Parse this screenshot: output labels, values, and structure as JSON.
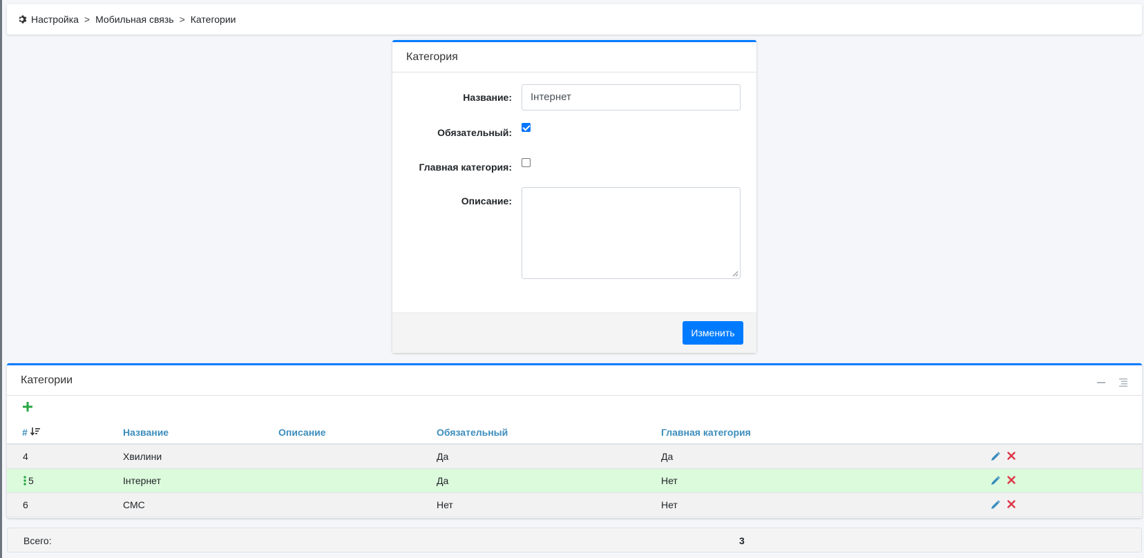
{
  "breadcrumb": {
    "items": [
      "Настройка",
      "Мобильная связь",
      "Категории"
    ],
    "separator": ">",
    "icon": "gear-icon"
  },
  "form": {
    "title": "Категория",
    "name_label": "Название:",
    "name_value": "Інтернет",
    "required_label": "Обязательный:",
    "required_checked": true,
    "main_label": "Главная категория:",
    "main_checked": false,
    "description_label": "Описание:",
    "description_value": "",
    "submit_label": "Изменить"
  },
  "table": {
    "title": "Категории",
    "columns": {
      "id": "#",
      "name": "Название",
      "description": "Описание",
      "required": "Обязательный",
      "main": "Главная категория"
    },
    "rows": [
      {
        "id": "4",
        "name": "Хвилини",
        "description": "",
        "required": "Да",
        "main": "Да",
        "selected": false
      },
      {
        "id": "5",
        "name": "Інтернет",
        "description": "",
        "required": "Да",
        "main": "Нет",
        "selected": true
      },
      {
        "id": "6",
        "name": "СМС",
        "description": "",
        "required": "Нет",
        "main": "Нет",
        "selected": false
      }
    ]
  },
  "footer": {
    "total_label": "Всего:",
    "total_value": "3"
  },
  "colors": {
    "accent": "#007bff",
    "header_link": "#3c8dbc",
    "selected_row": "#dcfadc",
    "add": "#28a745",
    "delete": "#dc3545"
  }
}
